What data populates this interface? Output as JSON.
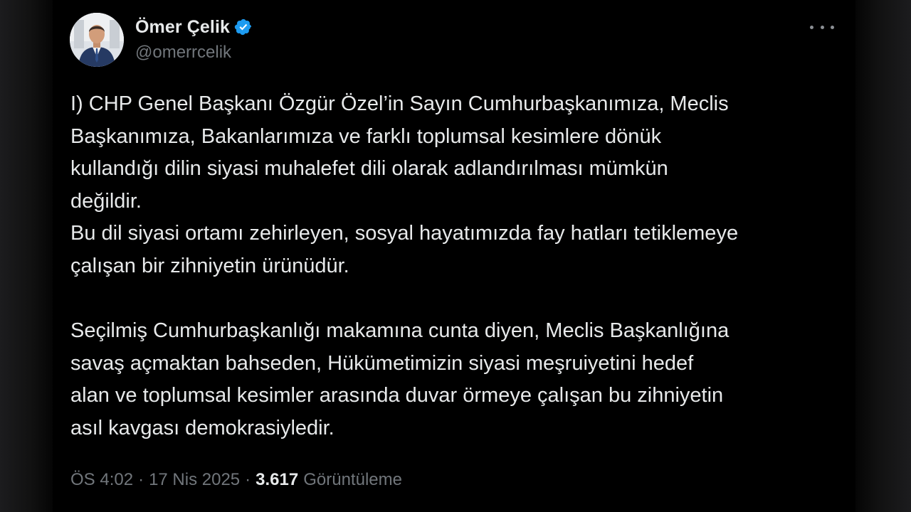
{
  "author": {
    "display_name": "Ömer Çelik",
    "handle": "@omerrcelik",
    "verified": true,
    "verified_color": "#1d9bf0"
  },
  "tweet": {
    "paragraph1": "I) CHP Genel Başkanı Özgür Özel’in Sayın Cumhurbaşkanımıza, Meclis\nBaşkanımıza, Bakanlarımıza ve farklı toplumsal kesimlere dönük\nkullandığı dilin siyasi muhalefet dili olarak adlandırılması  mümkün\ndeğildir.\nBu dil siyasi ortamı zehirleyen, sosyal hayatımızda fay hatları tetiklemeye\nçalışan bir zihniyetin ürünüdür.",
    "paragraph2": "Seçilmiş Cumhurbaşkanlığı makamına cunta diyen, Meclis Başkanlığına\nsavaş açmaktan bahseden,  Hükümetimizin siyasi meşruiyetini hedef\nalan ve toplumsal kesimler arasında duvar örmeye çalışan bu zihniyetin\nasıl kavgası demokrasiyledir."
  },
  "meta": {
    "time": "ÖS 4:02",
    "separator": "·",
    "date": "17 Nis 2025",
    "views_count": "3.617",
    "views_label": "Görüntüleme"
  },
  "icons": {
    "more": "more-options-icon",
    "verified": "verified-badge-icon"
  }
}
